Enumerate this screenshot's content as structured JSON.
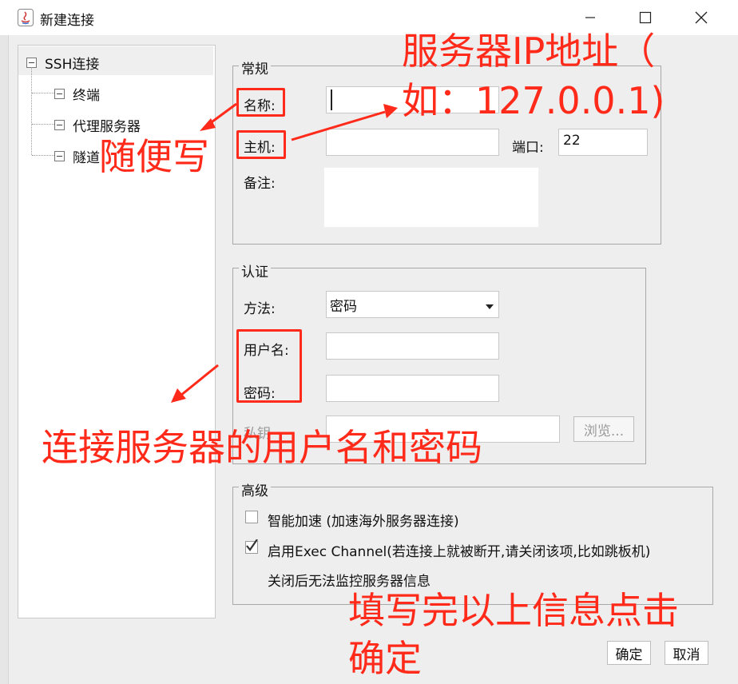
{
  "window": {
    "title": "新建连接"
  },
  "tree": {
    "root": "SSH连接",
    "children": [
      "终端",
      "代理服务器",
      "隧道"
    ]
  },
  "general": {
    "title": "常规",
    "name_label": "名称:",
    "name_value": "",
    "host_label": "主机:",
    "host_value": "",
    "port_label": "端口:",
    "port_value": "22",
    "note_label": "备注:",
    "note_value": ""
  },
  "auth": {
    "title": "认证",
    "method_label": "方法:",
    "method_value": "密码",
    "user_label": "用户名:",
    "user_value": "",
    "password_label": "密码:",
    "password_value": "",
    "keyfile_label": "私钥",
    "keyfile_value": "",
    "browse_label": "浏览..."
  },
  "advanced": {
    "title": "高级",
    "accelerate_label": "智能加速 (加速海外服务器连接)",
    "accelerate_checked": false,
    "exec_label": "启用Exec Channel(若连接上就被断开,请关闭该项,比如跳板机)",
    "exec_checked": true,
    "exec_note": "关闭后无法监控服务器信息"
  },
  "buttons": {
    "ok": "确定",
    "cancel": "取消"
  },
  "annotations": {
    "ip_line1": "服务器IP地址（",
    "ip_line2": "如：127.0.0.1)",
    "random": "随便写",
    "credentials": "连接服务器的用户名和密码",
    "done_line1": "填写完以上信息点击",
    "done_line2": "确定"
  },
  "colors": {
    "annotation": "#ff2a1a",
    "background": "#eeeeee"
  }
}
